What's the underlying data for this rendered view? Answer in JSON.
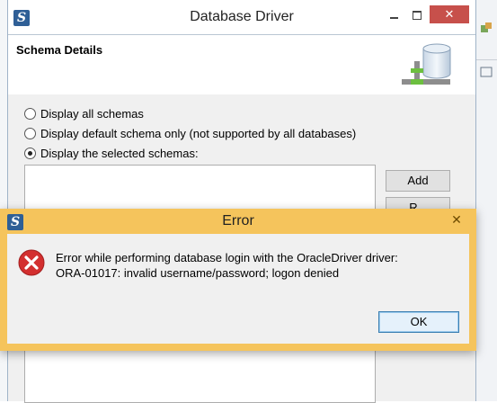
{
  "driver_window": {
    "title": "Database Driver",
    "header_title": "Schema Details",
    "options": [
      {
        "label": "Display all schemas",
        "selected": false
      },
      {
        "label": "Display default schema only (not supported by all databases)",
        "selected": false
      },
      {
        "label": "Display the selected schemas:",
        "selected": true
      }
    ],
    "buttons": {
      "add": "Add",
      "remove_partial": "R"
    }
  },
  "error_dialog": {
    "title": "Error",
    "message_line1": "Error while performing database login with the OracleDriver driver:",
    "message_line2": "ORA-01017: invalid username/password; logon denied",
    "ok_label": "OK",
    "close_glyph": "✕"
  },
  "colors": {
    "error_frame": "#f5c45c",
    "close_button": "#c7504b",
    "dialog_bg": "#f0f0f0",
    "error_icon": "#d32f2f"
  }
}
